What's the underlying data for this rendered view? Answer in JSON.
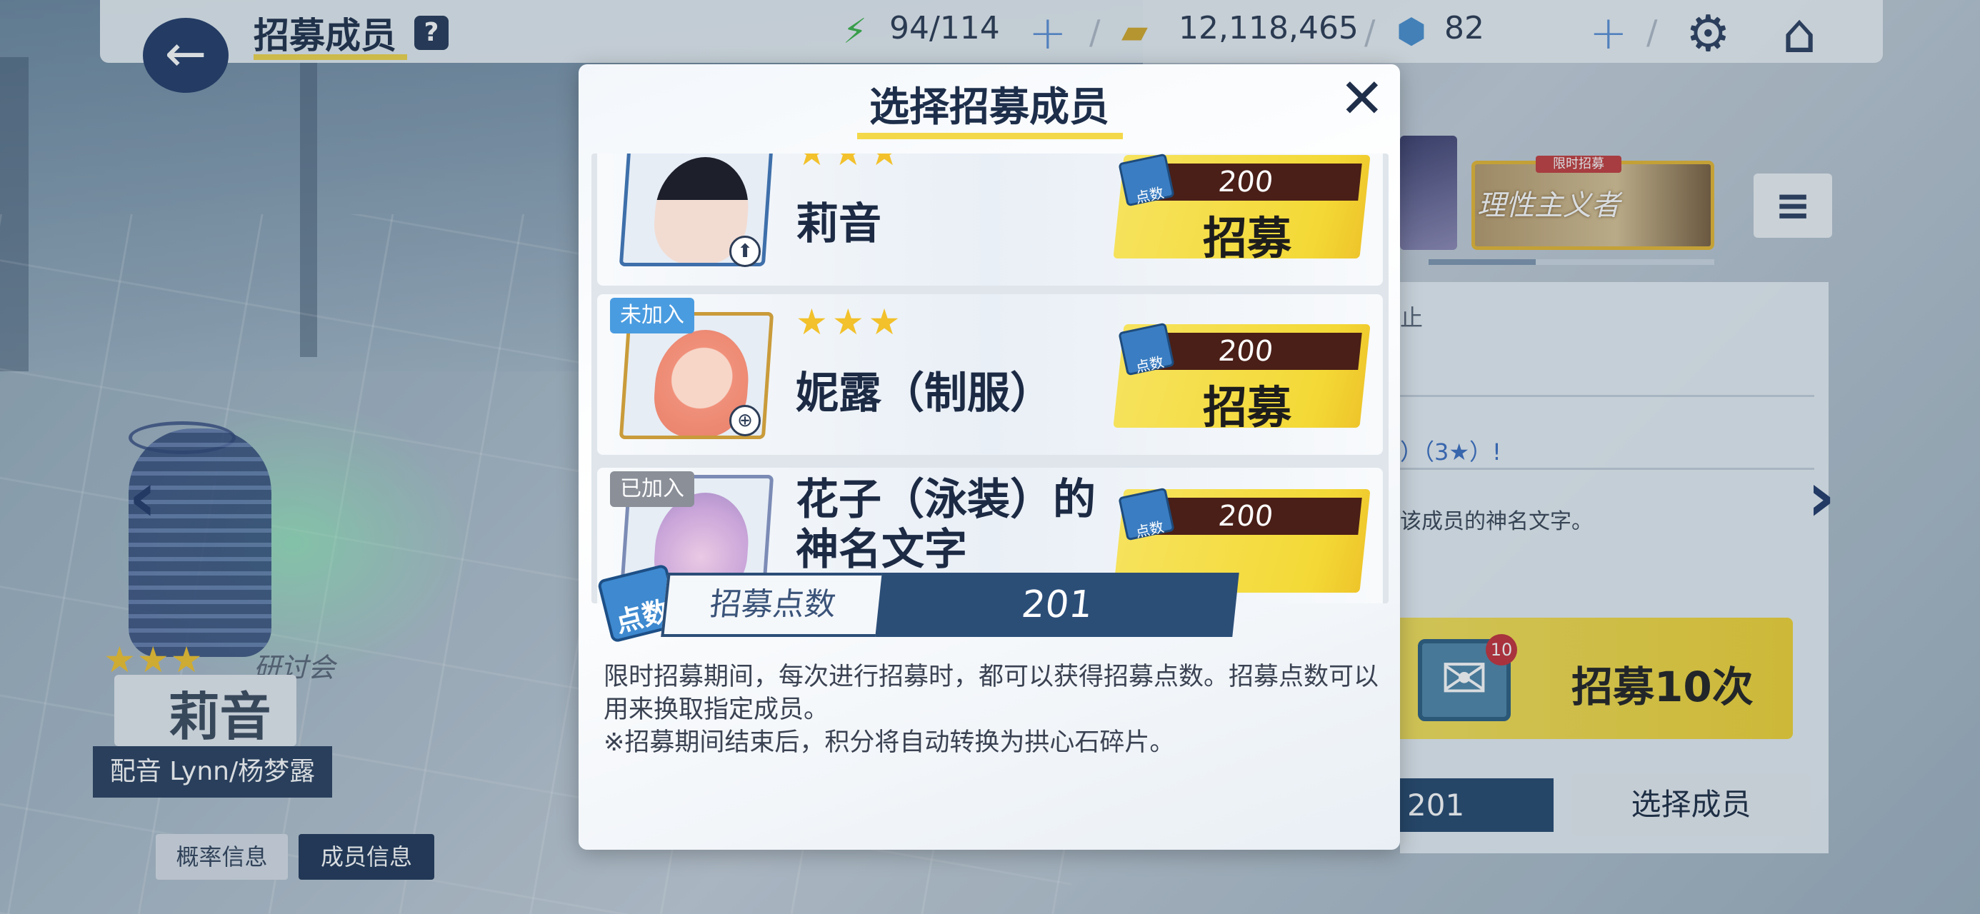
{
  "header": {
    "title": "招募成员",
    "help_label": "?",
    "stamina": "94/114",
    "credits": "12,118,465",
    "gems": "82"
  },
  "left": {
    "stars": "★★★",
    "group": "研讨会",
    "character_name": "莉音",
    "cv": "配音 Lynn/杨梦露",
    "buttons": {
      "probability": "概率信息",
      "member_info": "成员信息"
    }
  },
  "right": {
    "banner_text": "理性主义者",
    "banner_tag": "限时招募",
    "text_1": "止",
    "text_2": "）（3★）!",
    "text_3": "该成员的神名文字。",
    "recruit10_label": "招募10次",
    "mail_badge": "10",
    "points_value": "201",
    "select_member_label": "选择成员"
  },
  "modal": {
    "title": "选择招募成员",
    "close_label": "✕",
    "members": [
      {
        "status": "",
        "stars": "★★★",
        "name": "莉音",
        "cost": "200",
        "recruit_label": "招募",
        "role_icon": "support-icon"
      },
      {
        "status": "未加入",
        "stars": "★★★",
        "name": "妮露（制服）",
        "cost": "200",
        "recruit_label": "招募",
        "role_icon": "crosshair-icon"
      },
      {
        "status": "已加入",
        "stars": "",
        "name": "花子（泳装）的神名文字",
        "cost": "200",
        "recruit_label": "招募",
        "role_icon": ""
      }
    ],
    "points_icon_label": "点数",
    "points_label": "招募点数",
    "points_value": "201",
    "description_1": "限时招募期间，每次进行招募时，都可以获得招募点数。招募点数可以用来换取指定成员。",
    "description_2": "※招募期间结束后，积分将自动转换为拱心石碎片。"
  },
  "colors": {
    "accent_yellow": "#f4d936",
    "navy": "#243c69",
    "cost_bar": "#4a1f17",
    "tag_blue": "#4a9ce0",
    "tag_gray": "#8a8f98"
  }
}
